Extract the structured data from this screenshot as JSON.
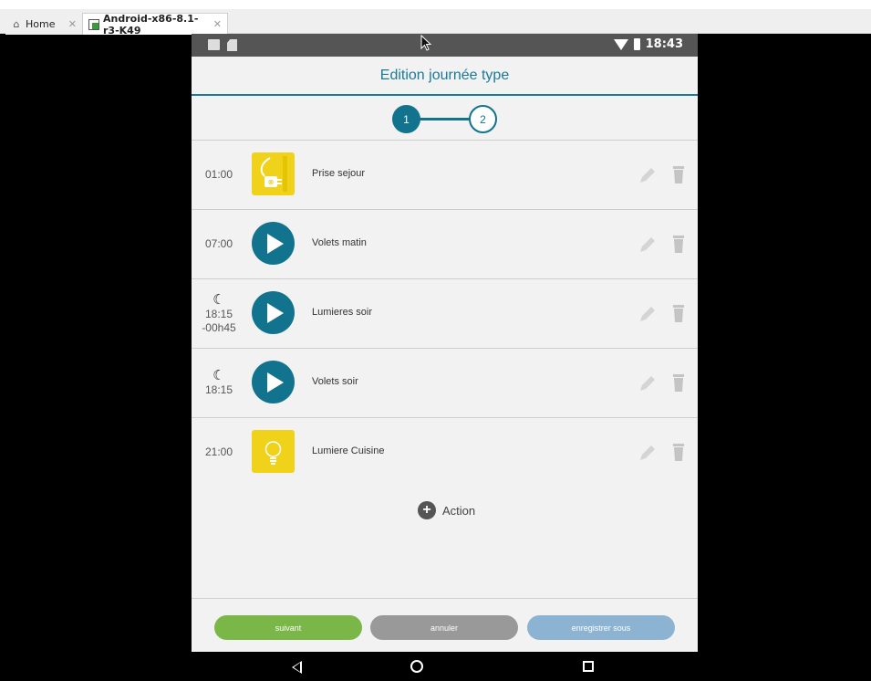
{
  "host_tabs": [
    {
      "label": "Home",
      "icon": "home-icon"
    },
    {
      "label": "Android-x86-8.1-r3-K49",
      "icon": "vm-icon"
    }
  ],
  "statusbar": {
    "time": "18:43"
  },
  "header": {
    "title": "Edition journée type"
  },
  "stepper": {
    "step1": "1",
    "step2": "2",
    "active": 1
  },
  "rows": [
    {
      "time": "01:00",
      "offset": "",
      "moon": false,
      "icon": "smart-plug-icon",
      "label": "Prise sejour"
    },
    {
      "time": "07:00",
      "offset": "",
      "moon": false,
      "icon": "play-icon",
      "label": "Volets matin"
    },
    {
      "time": "18:15",
      "offset": "-00h45",
      "moon": true,
      "icon": "play-icon",
      "label": "Lumieres soir"
    },
    {
      "time": "18:15",
      "offset": "",
      "moon": true,
      "icon": "play-icon",
      "label": "Volets soir"
    },
    {
      "time": "21:00",
      "offset": "",
      "moon": false,
      "icon": "light-bulb-icon",
      "label": "Lumiere Cuisine"
    }
  ],
  "add_action": {
    "label": "Action"
  },
  "buttons": {
    "next": "suivant",
    "cancel": "annuler",
    "save_as": "enregistrer sous"
  },
  "colors": {
    "primary": "#12738f",
    "next": "#7ab648",
    "cancel": "#999999",
    "save_as": "#8cb4d2",
    "device_tile": "#f0d21a"
  }
}
